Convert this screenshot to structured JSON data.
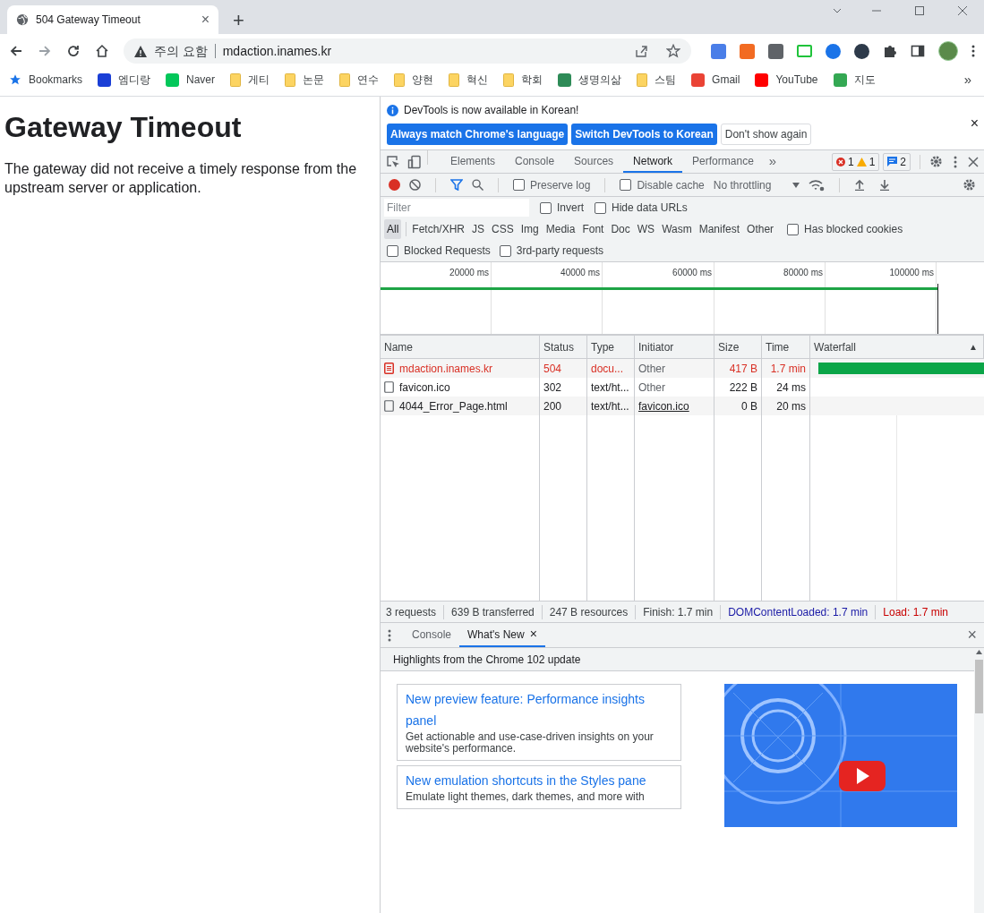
{
  "browser": {
    "tab": {
      "title": "504 Gateway Timeout",
      "close": "×"
    },
    "new_tab": "+",
    "address": {
      "warning": "주의 요함",
      "url": "mdaction.inames.kr"
    },
    "bookmarks": [
      {
        "kind": "star",
        "label": "Bookmarks",
        "color": "#1a73e8"
      },
      {
        "kind": "site",
        "label": "엠디랑",
        "color": "#1a3fd6"
      },
      {
        "kind": "site",
        "label": "Naver",
        "color": "#03c75a"
      },
      {
        "kind": "folder",
        "label": "게티",
        "color": "#fcd462"
      },
      {
        "kind": "folder",
        "label": "논문",
        "color": "#fcd462"
      },
      {
        "kind": "folder",
        "label": "연수",
        "color": "#fcd462"
      },
      {
        "kind": "folder",
        "label": "양현",
        "color": "#fcd462"
      },
      {
        "kind": "folder",
        "label": "혁신",
        "color": "#fcd462"
      },
      {
        "kind": "folder",
        "label": "학회",
        "color": "#fcd462"
      },
      {
        "kind": "site",
        "label": "생명의삶",
        "color": "#2e8b57"
      },
      {
        "kind": "folder",
        "label": "스팀",
        "color": "#fcd462"
      },
      {
        "kind": "site",
        "label": "Gmail",
        "color": "#ea4335"
      },
      {
        "kind": "site",
        "label": "YouTube",
        "color": "#ff0000"
      },
      {
        "kind": "site",
        "label": "지도",
        "color": "#34a853"
      }
    ],
    "more": "»"
  },
  "page": {
    "heading": "Gateway Timeout",
    "body": "The gateway did not receive a timely response from the upstream server or application."
  },
  "devtools": {
    "infobar": {
      "message": "DevTools is now available in Korean!",
      "buttons": [
        {
          "label": "Always match Chrome's language",
          "kind": "primary"
        },
        {
          "label": "Switch DevTools to Korean",
          "kind": "primary"
        },
        {
          "label": "Don't show again",
          "kind": "plain"
        }
      ],
      "close": "×"
    },
    "tabs": [
      {
        "label": "Elements",
        "selected": false
      },
      {
        "label": "Console",
        "selected": false
      },
      {
        "label": "Sources",
        "selected": false
      },
      {
        "label": "Network",
        "selected": true
      },
      {
        "label": "Performance",
        "selected": false
      }
    ],
    "more_tabs": "»",
    "counts": {
      "errors": "1",
      "warnings": "1",
      "messages": "2"
    },
    "toolbar": {
      "preserve_log": {
        "label": "Preserve log",
        "checked": false
      },
      "disable_cache": {
        "label": "Disable cache",
        "checked": false
      },
      "throttling": "No throttling"
    },
    "filter": {
      "placeholder": "Filter",
      "invert": {
        "label": "Invert",
        "checked": false
      },
      "hide_data_urls": {
        "label": "Hide data URLs",
        "checked": false
      }
    },
    "types": [
      {
        "label": "All",
        "selected": true
      },
      {
        "label": "Fetch/XHR",
        "selected": false
      },
      {
        "label": "JS",
        "selected": false
      },
      {
        "label": "CSS",
        "selected": false
      },
      {
        "label": "Img",
        "selected": false
      },
      {
        "label": "Media",
        "selected": false
      },
      {
        "label": "Font",
        "selected": false
      },
      {
        "label": "Doc",
        "selected": false
      },
      {
        "label": "WS",
        "selected": false
      },
      {
        "label": "Wasm",
        "selected": false
      },
      {
        "label": "Manifest",
        "selected": false
      },
      {
        "label": "Other",
        "selected": false
      }
    ],
    "has_blocked_cookies": {
      "label": "Has blocked cookies",
      "checked": false
    },
    "blocked_requests": {
      "label": "Blocked Requests",
      "checked": false
    },
    "third_party": {
      "label": "3rd-party requests",
      "checked": false
    },
    "overview": {
      "ticks": [
        "20000 ms",
        "40000 ms",
        "60000 ms",
        "80000 ms",
        "100000 ms"
      ]
    },
    "table": {
      "columns": [
        "Name",
        "Status",
        "Type",
        "Initiator",
        "Size",
        "Time",
        "Waterfall"
      ],
      "sort_mark": "▲",
      "rows": [
        {
          "name": "mdaction.inames.kr",
          "status": "504",
          "type": "docu...",
          "initiator": "Other",
          "size": "417 B",
          "time": "1.7 min",
          "error": true,
          "initiator_link": false,
          "waterfall_bar": true
        },
        {
          "name": "favicon.ico",
          "status": "302",
          "type": "text/ht...",
          "initiator": "Other",
          "size": "222 B",
          "time": "24 ms",
          "error": false,
          "initiator_link": false,
          "waterfall_bar": false
        },
        {
          "name": "4044_Error_Page.html",
          "status": "200",
          "type": "text/ht...",
          "initiator": "favicon.ico",
          "size": "0 B",
          "time": "20 ms",
          "error": false,
          "initiator_link": true,
          "waterfall_bar": false
        }
      ]
    },
    "summary": [
      {
        "text": "3 requests",
        "kind": "plain"
      },
      {
        "text": "639 B transferred",
        "kind": "plain"
      },
      {
        "text": "247 B resources",
        "kind": "plain"
      },
      {
        "text": "Finish: 1.7 min",
        "kind": "plain"
      },
      {
        "text": "DOMContentLoaded: 1.7 min",
        "kind": "dom"
      },
      {
        "text": "Load: 1.7 min",
        "kind": "load"
      }
    ],
    "drawer": {
      "tabs": [
        {
          "label": "Console",
          "selected": false,
          "closable": false
        },
        {
          "label": "What's New",
          "selected": true,
          "closable": true
        }
      ],
      "tab_close": "×",
      "close": "×",
      "highlights": "Highlights from the Chrome 102 update",
      "cards": [
        {
          "title": "New preview feature: Performance insights panel",
          "body": "Get actionable and use-case-driven insights on your website's performance."
        },
        {
          "title": "New emulation shortcuts in the Styles pane",
          "body": "Emulate light themes, dark themes, and more with"
        }
      ]
    }
  }
}
